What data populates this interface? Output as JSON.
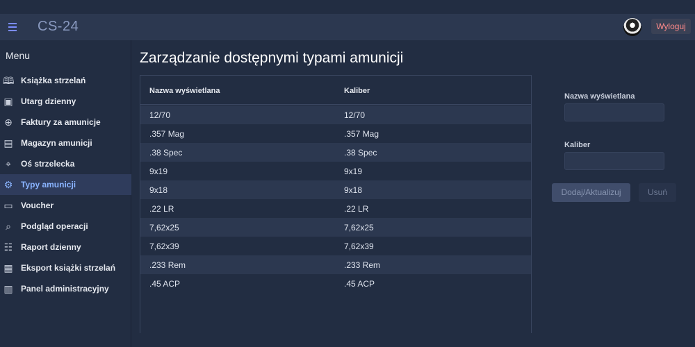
{
  "header": {
    "brand": "CS-24",
    "logout_label": "Wyloguj"
  },
  "sidebar": {
    "title": "Menu",
    "items": [
      {
        "label": "Książka strzelań",
        "icon": "book-icon",
        "active": false
      },
      {
        "label": "Utarg dzienny",
        "icon": "cash-icon",
        "active": false
      },
      {
        "label": "Faktury za amunicje",
        "icon": "plus-circle-icon",
        "active": false
      },
      {
        "label": "Magazyn amunicji",
        "icon": "cabinet-icon",
        "active": false
      },
      {
        "label": "Oś strzelecka",
        "icon": "crosshair-icon",
        "active": false
      },
      {
        "label": "Typy amunicji",
        "icon": "gears-icon",
        "active": true
      },
      {
        "label": "Voucher",
        "icon": "card-icon",
        "active": false
      },
      {
        "label": "Podgląd operacji",
        "icon": "search-icon",
        "active": false
      },
      {
        "label": "Raport dzienny",
        "icon": "report-icon",
        "active": false
      },
      {
        "label": "Eksport książki strzelań",
        "icon": "archive-icon",
        "active": false
      },
      {
        "label": "Panel administracyjny",
        "icon": "building-icon",
        "active": false
      }
    ]
  },
  "main": {
    "title": "Zarządzanie dostępnymi typami amunicji",
    "table": {
      "columns": [
        "Nazwa wyświetlana",
        "Kaliber"
      ],
      "rows": [
        [
          "12/70",
          "12/70"
        ],
        [
          ".357 Mag",
          ".357 Mag"
        ],
        [
          ".38 Spec",
          ".38 Spec"
        ],
        [
          "9x19",
          "9x19"
        ],
        [
          "9x18",
          "9x18"
        ],
        [
          ".22 LR",
          ".22 LR"
        ],
        [
          "7,62x25",
          "7,62x25"
        ],
        [
          "7,62x39",
          "7,62x39"
        ],
        [
          ".233 Rem",
          ".233 Rem"
        ],
        [
          ".45 ACP",
          ".45 ACP"
        ]
      ]
    }
  },
  "form": {
    "name_label": "Nazwa wyświetlana",
    "name_value": "",
    "caliber_label": "Kaliber",
    "caliber_value": "",
    "submit_label": "Dodaj/Aktualizuj",
    "delete_label": "Usuń"
  }
}
